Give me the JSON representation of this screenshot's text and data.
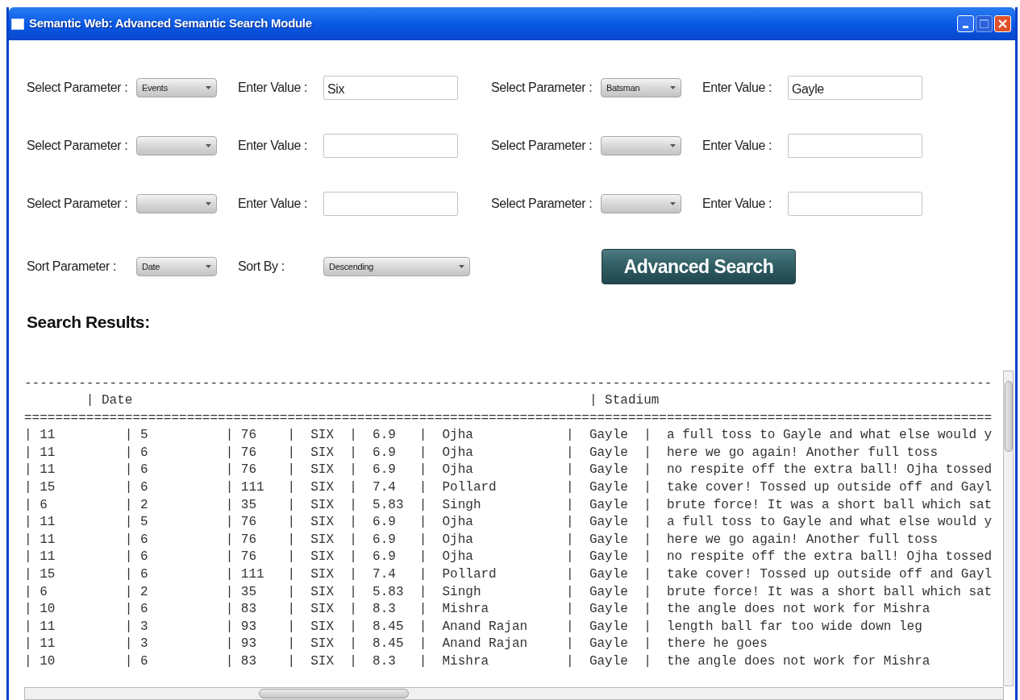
{
  "window": {
    "title": "Semantic Web: Advanced Semantic Search Module"
  },
  "criteria": [
    {
      "param_label": "Select Parameter :",
      "param_value": "Events",
      "value_label": "Enter Value :",
      "value": "Six"
    },
    {
      "param_label": "Select Parameter :",
      "param_value": "Batsman",
      "value_label": "Enter Value :",
      "value": "Gayle"
    },
    {
      "param_label": "Select Parameter :",
      "value_label": "Enter Value :"
    },
    {
      "param_label": "Select Parameter :",
      "value_label": "Enter Value :"
    },
    {
      "param_label": "Select Parameter :",
      "value_label": "Enter Value :"
    },
    {
      "param_label": "Select Parameter :",
      "value_label": "Enter Value :"
    }
  ],
  "sort": {
    "param_label": "Sort Parameter :",
    "param_value": "Date",
    "order_label": "Sort By :",
    "order_value": "Descending"
  },
  "search_button": "Advanced Search",
  "results": {
    "title": "Search Results:",
    "lines": [
      "-----------------------------------------------------------------------------------------------------------------------------",
      "        | Date                                                           | Stadium",
      "=============================================================================================================================",
      "| 11         | 5          | 76    |  SIX  |  6.9   |  Ojha            |  Gayle  |  a full toss to Gayle and what else would y",
      "| 11         | 6          | 76    |  SIX  |  6.9   |  Ojha            |  Gayle  |  here we go again! Another full toss",
      "| 11         | 6          | 76    |  SIX  |  6.9   |  Ojha            |  Gayle  |  no respite off the extra ball! Ojha tossed",
      "| 15         | 6          | 111   |  SIX  |  7.4   |  Pollard         |  Gayle  |  take cover! Tossed up outside off and Gayl",
      "| 6          | 2          | 35    |  SIX  |  5.83  |  Singh           |  Gayle  |  brute force! It was a short ball which sat",
      "| 11         | 5          | 76    |  SIX  |  6.9   |  Ojha            |  Gayle  |  a full toss to Gayle and what else would y",
      "| 11         | 6          | 76    |  SIX  |  6.9   |  Ojha            |  Gayle  |  here we go again! Another full toss",
      "| 11         | 6          | 76    |  SIX  |  6.9   |  Ojha            |  Gayle  |  no respite off the extra ball! Ojha tossed",
      "| 15         | 6          | 111   |  SIX  |  7.4   |  Pollard         |  Gayle  |  take cover! Tossed up outside off and Gayl",
      "| 6          | 2          | 35    |  SIX  |  5.83  |  Singh           |  Gayle  |  brute force! It was a short ball which sat",
      "| 10         | 6          | 83    |  SIX  |  8.3   |  Mishra          |  Gayle  |  the angle does not work for Mishra",
      "| 11         | 3          | 93    |  SIX  |  8.45  |  Anand Rajan     |  Gayle  |  length ball far too wide down leg",
      "| 11         | 3          | 93    |  SIX  |  8.45  |  Anand Rajan     |  Gayle  |  there he goes",
      "| 10         | 6          | 83    |  SIX  |  8.3   |  Mishra          |  Gayle  |  the angle does not work for Mishra"
    ]
  }
}
